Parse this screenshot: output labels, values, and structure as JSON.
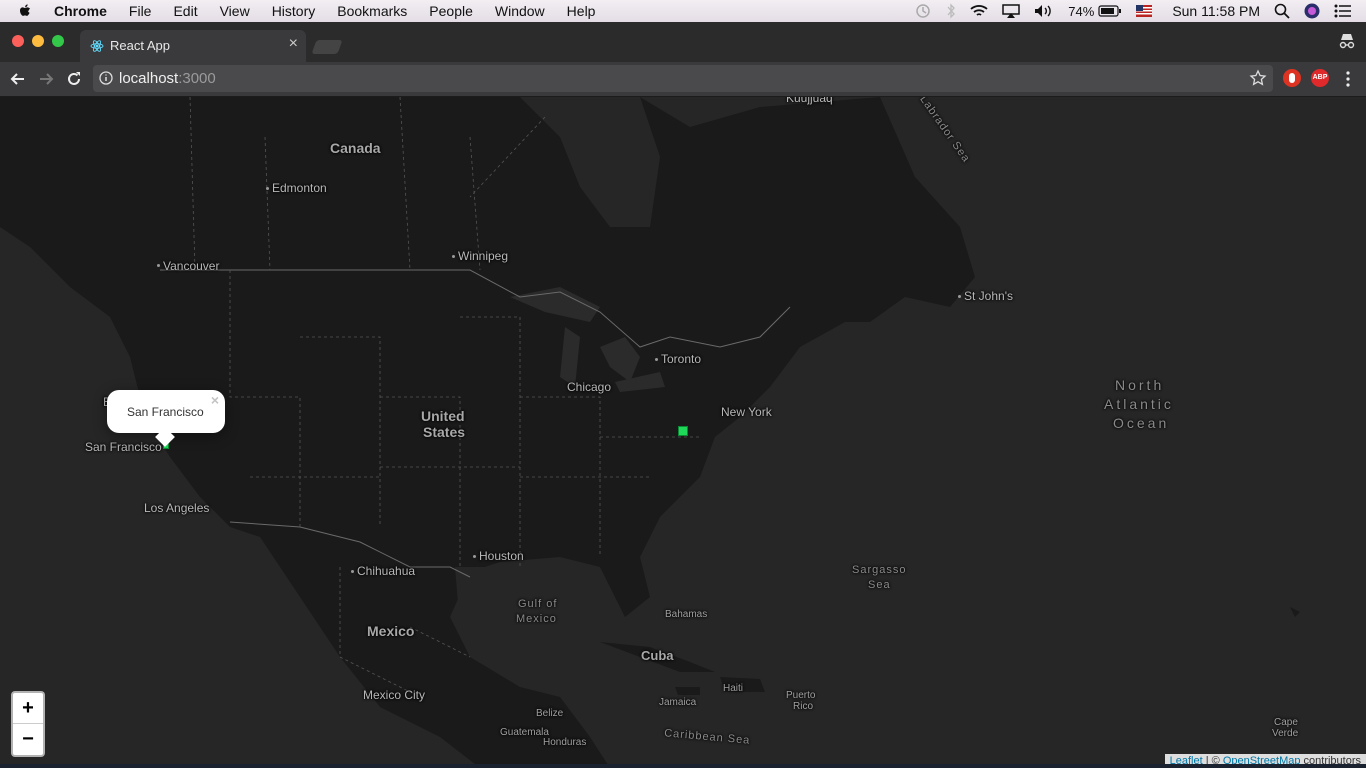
{
  "menubar": {
    "app": "Chrome",
    "items": [
      "File",
      "Edit",
      "View",
      "History",
      "Bookmarks",
      "People",
      "Window",
      "Help"
    ],
    "battery": "74%",
    "clock": "Sun 11:58 PM"
  },
  "tab": {
    "title": "React App",
    "close": "×"
  },
  "address": {
    "host": "localhost",
    "port": ":3000"
  },
  "map": {
    "labels": {
      "canada": "Canada",
      "edmonton": "Edmonton",
      "vancouver": "Vancouver",
      "winnipeg": "Winnipeg",
      "kuujjuaq": "Kuujjuaq",
      "labrador": "Labrador Sea",
      "stjohns": "St John's",
      "toronto": "Toronto",
      "chicago": "Chicago",
      "newyork": "New York",
      "us1": "United",
      "us2": "States",
      "sanfrancisco": "San Francisco",
      "losangeles": "Los Angeles",
      "houston": "Houston",
      "chihuahua": "Chihuahua",
      "mexico": "Mexico",
      "mexicocity": "Mexico City",
      "gulf1": "Gulf of",
      "gulf2": "Mexico",
      "bahamas": "Bahamas",
      "cuba": "Cuba",
      "haiti": "Haiti",
      "jamaica": "Jamaica",
      "pr1": "Puerto",
      "pr2": "Rico",
      "belize": "Belize",
      "guatemala": "Guatemala",
      "honduras": "Honduras",
      "caribbean": "Caribbean Sea",
      "sargasso1": "Sargasso",
      "sargasso2": "Sea",
      "atlantic1": "North",
      "atlantic2": "Atlantic",
      "atlantic3": "Ocean",
      "capeverde1": "Cape",
      "capeverde2": "Verde",
      "clipped_b": "B"
    },
    "popup": {
      "text": "San Francisco",
      "close": "×"
    },
    "zoom_in": "+",
    "zoom_out": "−",
    "attribution": {
      "leaflet": "Leaflet",
      "sep": " | © ",
      "osm": "OpenStreetMap",
      "rest": " contributors"
    }
  }
}
